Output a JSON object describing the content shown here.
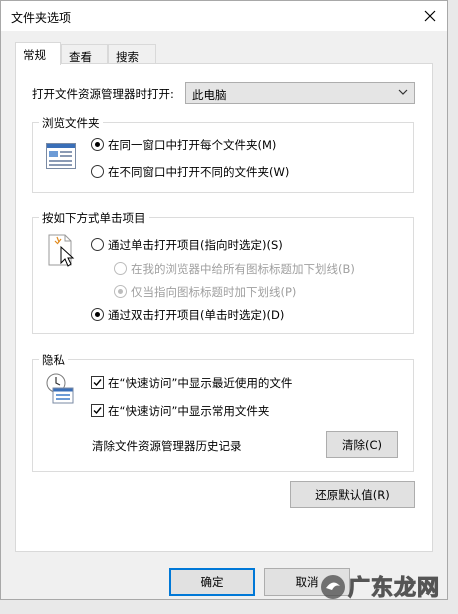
{
  "window": {
    "title": "文件夹选项"
  },
  "tabs": [
    {
      "label": "常规"
    },
    {
      "label": "查看"
    },
    {
      "label": "搜索"
    }
  ],
  "open_with": {
    "label": "打开文件资源管理器时打开:",
    "value": "此电脑"
  },
  "browse": {
    "legend": "浏览文件夹",
    "options": [
      {
        "label": "在同一窗口中打开每个文件夹(M)",
        "checked": true
      },
      {
        "label": "在不同窗口中打开不同的文件夹(W)",
        "checked": false
      }
    ]
  },
  "click": {
    "legend": "按如下方式单击项目",
    "single": "通过单击打开项目(指向时选定)(S)",
    "underline_all": "在我的浏览器中给所有图标标题加下划线(B)",
    "underline_point": "仅当指向图标标题时加下划线(P)",
    "double": "通过双击打开项目(单击时选定)(D)"
  },
  "privacy": {
    "legend": "隐私",
    "recent": "在“快速访问”中显示最近使用的文件",
    "frequent": "在“快速访问”中显示常用文件夹",
    "clear_label": "清除文件资源管理器历史记录",
    "clear_button": "清除(C)"
  },
  "restore_button": "还原默认值(R)",
  "ok_button": "确定",
  "cancel_button": "取消",
  "background": {
    "left_number": "11",
    "watermark": "广东龙网"
  }
}
